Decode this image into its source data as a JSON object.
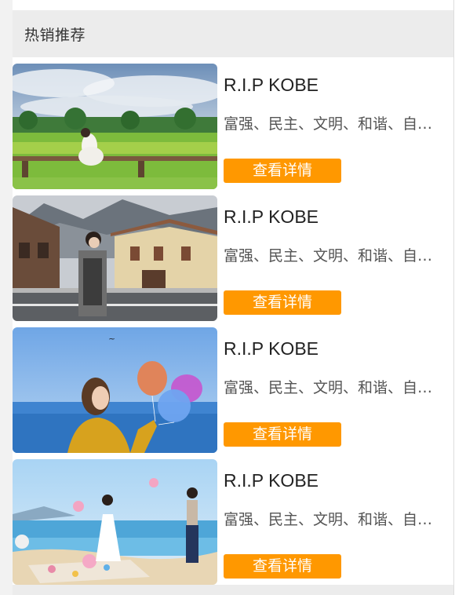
{
  "section": {
    "title": "热销推荐"
  },
  "items": [
    {
      "title": "R.I.P KOBE",
      "description": "富强、民主、文明、和谐、自由、平等、公正、法治",
      "button_label": "查看详情",
      "image": "couple-photo-meadow-bench"
    },
    {
      "title": "R.I.P KOBE",
      "description": "富强、民主、文明、和谐、自由、平等、公正、法治",
      "button_label": "查看详情",
      "image": "couple-photo-village-street"
    },
    {
      "title": "R.I.P KOBE",
      "description": "富强、民主、文明、和谐、自由、平等、公正、法治",
      "button_label": "查看详情",
      "image": "couple-photo-sea-balloons"
    },
    {
      "title": "R.I.P KOBE",
      "description": "富强、民主、文明、和谐、自由、平等、公正、法治",
      "button_label": "查看详情",
      "image": "couple-photo-beach-wedding"
    }
  ],
  "colors": {
    "accent": "#ff9800",
    "header_bg": "#ececec"
  }
}
